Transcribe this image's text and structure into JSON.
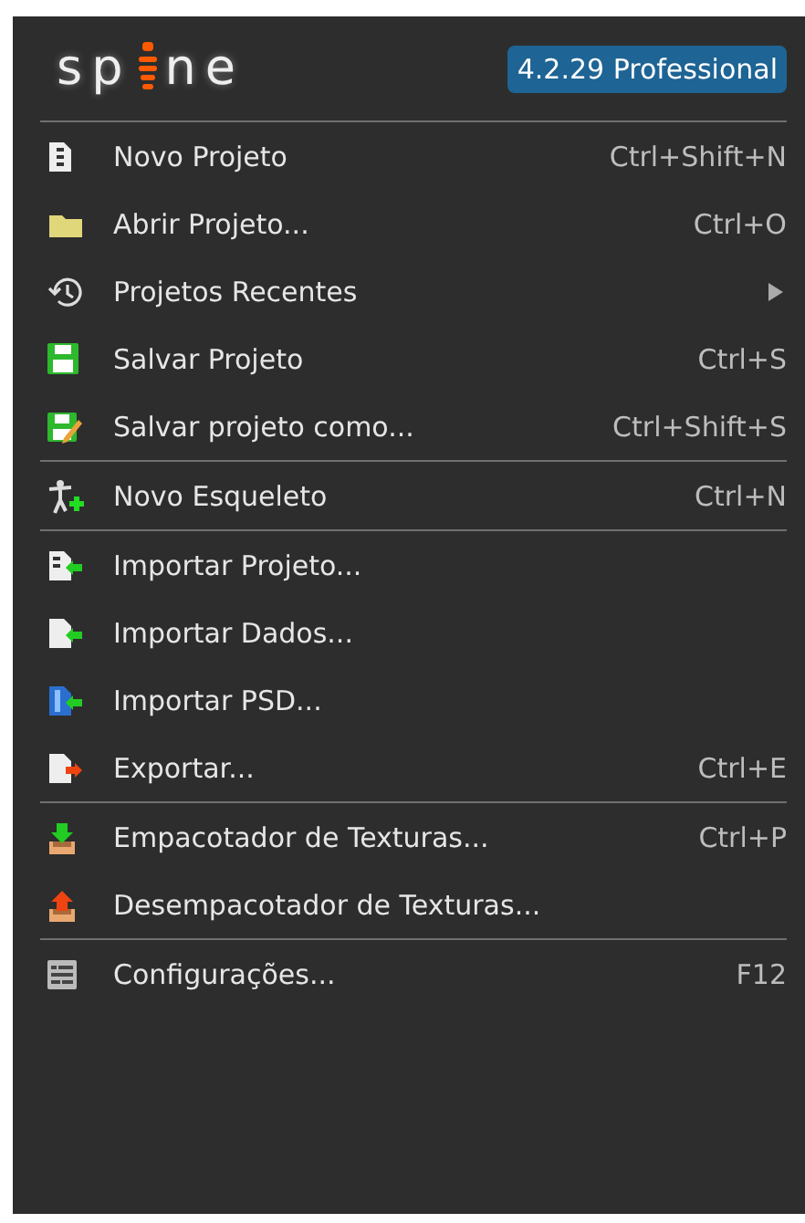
{
  "header": {
    "logo_left": "sp",
    "logo_right": "ne",
    "version": "4.2.29 Professional"
  },
  "sections": [
    {
      "items": [
        {
          "kind": "action",
          "label": "Novo Projeto",
          "shortcut": "Ctrl+Shift+N"
        },
        {
          "kind": "action",
          "label": "Abrir Projeto...",
          "shortcut": "Ctrl+O"
        },
        {
          "kind": "submenu",
          "label": "Projetos Recentes"
        },
        {
          "kind": "action",
          "label": "Salvar Projeto",
          "shortcut": "Ctrl+S"
        },
        {
          "kind": "action",
          "label": "Salvar projeto como...",
          "shortcut": "Ctrl+Shift+S"
        }
      ]
    },
    {
      "items": [
        {
          "kind": "action",
          "label": "Novo Esqueleto",
          "shortcut": "Ctrl+N"
        }
      ]
    },
    {
      "items": [
        {
          "kind": "action",
          "label": "Importar Projeto..."
        },
        {
          "kind": "action",
          "label": "Importar Dados..."
        },
        {
          "kind": "action",
          "label": "Importar PSD..."
        },
        {
          "kind": "action",
          "label": "Exportar...",
          "shortcut": "Ctrl+E"
        }
      ]
    },
    {
      "items": [
        {
          "kind": "action",
          "label": "Empacotador de Texturas...",
          "shortcut": "Ctrl+P"
        },
        {
          "kind": "action",
          "label": "Desempacotador de Texturas..."
        }
      ]
    },
    {
      "items": [
        {
          "kind": "action",
          "label": "Configurações...",
          "shortcut": "F12"
        }
      ]
    }
  ]
}
